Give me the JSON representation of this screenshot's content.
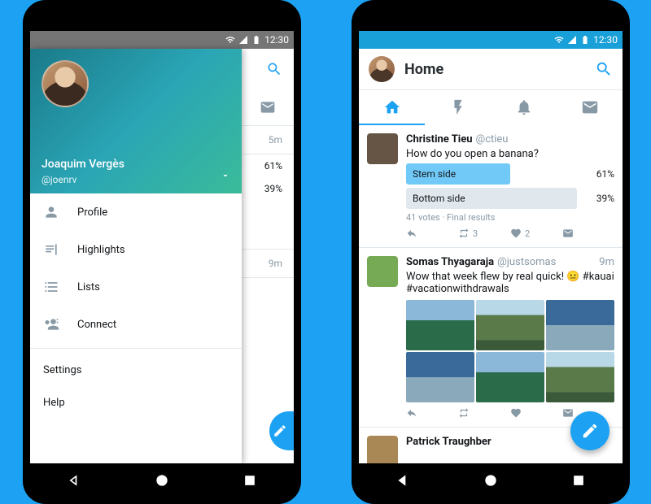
{
  "status": {
    "time": "12:30"
  },
  "drawer": {
    "name": "Joaquim Vergès",
    "handle": "@joenrv",
    "items": [
      {
        "label": "Profile"
      },
      {
        "label": "Highlights"
      },
      {
        "label": "Lists"
      },
      {
        "label": "Connect"
      }
    ],
    "settings": "Settings",
    "help": "Help"
  },
  "bg": {
    "time1": "5m",
    "pct1": "61%",
    "pct2": "39%",
    "time2": "9m"
  },
  "home": {
    "title": "Home",
    "tweets": [
      {
        "name": "Christine Tieu",
        "handle": "@ctieu",
        "text": "How do you open a banana?",
        "poll": {
          "opt1": "Stem side",
          "pct1": "61%",
          "opt2": "Bottom side",
          "pct2": "39%",
          "meta": "41 votes · Final results"
        },
        "actions": {
          "rt": "3",
          "like": "2"
        }
      },
      {
        "name": "Somas Thyagaraja",
        "handle": "@justsomas",
        "time": "9m",
        "text": "Wow that week flew by real quick! 😐 #kauai #vacationwithdrawals"
      },
      {
        "name": "Patrick Traughber"
      }
    ]
  }
}
